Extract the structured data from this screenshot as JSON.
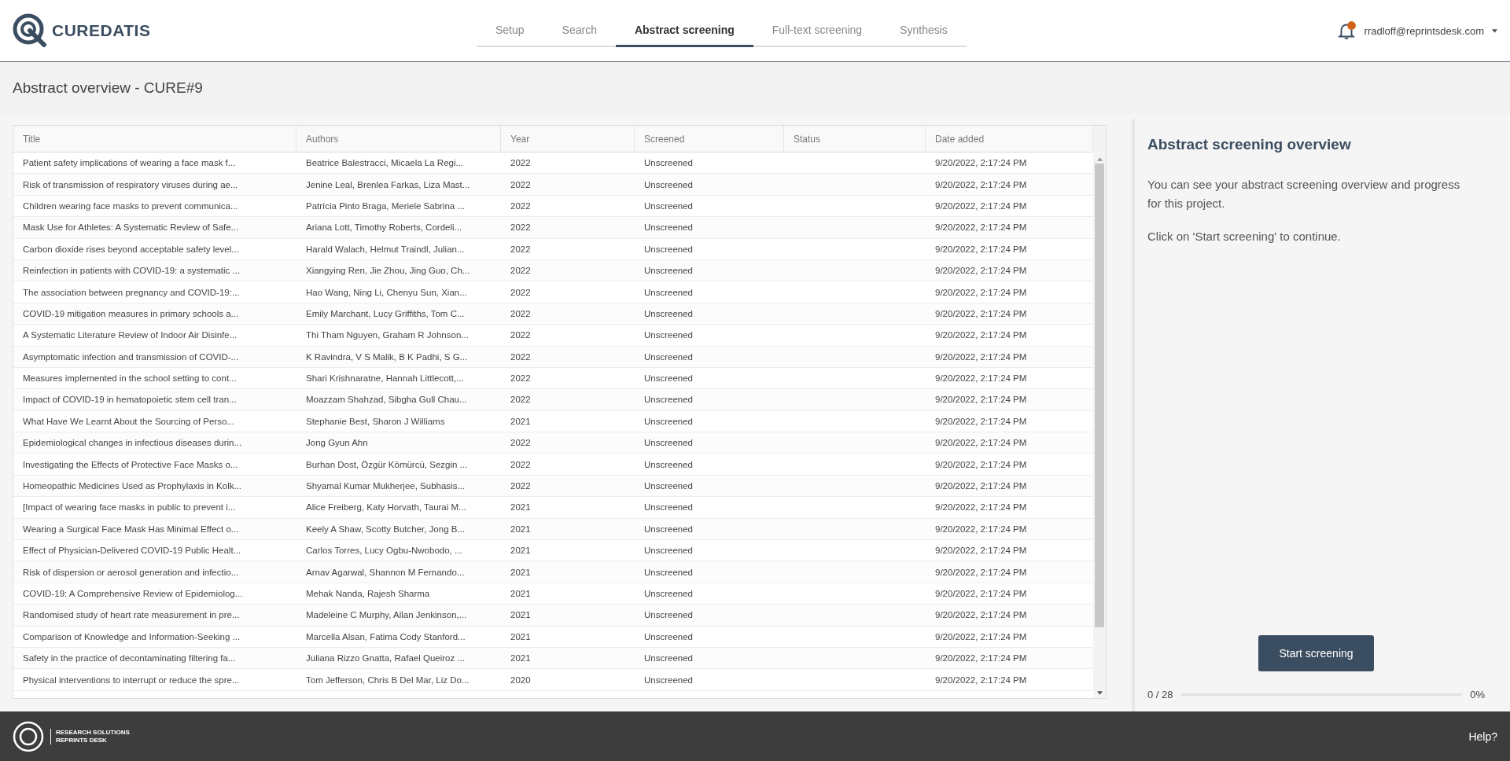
{
  "header": {
    "logo": "CUREDATIS",
    "tabs": [
      {
        "label": "Setup",
        "selected": false
      },
      {
        "label": "Search",
        "selected": false
      },
      {
        "label": "Abstract screening",
        "selected": true
      },
      {
        "label": "Full-text screening",
        "selected": false
      },
      {
        "label": "Synthesis",
        "selected": false
      }
    ],
    "user": "rradloff@reprintsdesk.com"
  },
  "page_title": "Abstract overview - CURE#9",
  "table": {
    "columns": [
      "Title",
      "Authors",
      "Year",
      "Screened",
      "Status",
      "Date added"
    ],
    "rows": [
      [
        "Patient safety implications of wearing a face mask f...",
        "Beatrice Balestracci, Micaela La Regi...",
        "2022",
        "Unscreened",
        "",
        "9/20/2022, 2:17:24 PM"
      ],
      [
        "Risk of transmission of respiratory viruses during ae...",
        "Jenine Leal, Brenlea Farkas, Liza Mast...",
        "2022",
        "Unscreened",
        "",
        "9/20/2022, 2:17:24 PM"
      ],
      [
        "Children wearing face masks to prevent communica...",
        "Patrícia Pinto Braga, Meriele Sabrina ...",
        "2022",
        "Unscreened",
        "",
        "9/20/2022, 2:17:24 PM"
      ],
      [
        "Mask Use for Athletes: A Systematic Review of Safe...",
        "Ariana Lott, Timothy Roberts, Cordeli...",
        "2022",
        "Unscreened",
        "",
        "9/20/2022, 2:17:24 PM"
      ],
      [
        "Carbon dioxide rises beyond acceptable safety level...",
        "Harald Walach, Helmut Traindl, Julian...",
        "2022",
        "Unscreened",
        "",
        "9/20/2022, 2:17:24 PM"
      ],
      [
        "Reinfection in patients with COVID-19: a systematic ...",
        "Xiangying Ren, Jie Zhou, Jing Guo, Ch...",
        "2022",
        "Unscreened",
        "",
        "9/20/2022, 2:17:24 PM"
      ],
      [
        "The association between pregnancy and COVID-19:...",
        "Hao Wang, Ning Li, Chenyu Sun, Xian...",
        "2022",
        "Unscreened",
        "",
        "9/20/2022, 2:17:24 PM"
      ],
      [
        "COVID-19 mitigation measures in primary schools a...",
        "Emily Marchant, Lucy Griffiths, Tom C...",
        "2022",
        "Unscreened",
        "",
        "9/20/2022, 2:17:24 PM"
      ],
      [
        "A Systematic Literature Review of Indoor Air Disinfe...",
        "Thi Tham Nguyen, Graham R Johnson...",
        "2022",
        "Unscreened",
        "",
        "9/20/2022, 2:17:24 PM"
      ],
      [
        "Asymptomatic infection and transmission of COVID-...",
        "K Ravindra, V S Malik, B K Padhi, S G...",
        "2022",
        "Unscreened",
        "",
        "9/20/2022, 2:17:24 PM"
      ],
      [
        "Measures implemented in the school setting to cont...",
        "Shari Krishnaratne, Hannah Littlecott,...",
        "2022",
        "Unscreened",
        "",
        "9/20/2022, 2:17:24 PM"
      ],
      [
        "Impact of COVID-19 in hematopoietic stem cell tran...",
        "Moazzam Shahzad, Sibgha Gull Chau...",
        "2022",
        "Unscreened",
        "",
        "9/20/2022, 2:17:24 PM"
      ],
      [
        "What Have We Learnt About the Sourcing of Perso...",
        "Stephanie Best, Sharon J Williams",
        "2021",
        "Unscreened",
        "",
        "9/20/2022, 2:17:24 PM"
      ],
      [
        "Epidemiological changes in infectious diseases durin...",
        "Jong Gyun Ahn",
        "2022",
        "Unscreened",
        "",
        "9/20/2022, 2:17:24 PM"
      ],
      [
        "Investigating the Effects of Protective Face Masks o...",
        "Burhan Dost, Özgür Kömürcü, Sezgin ...",
        "2022",
        "Unscreened",
        "",
        "9/20/2022, 2:17:24 PM"
      ],
      [
        "Homeopathic Medicines Used as Prophylaxis in Kolk...",
        "Shyamal Kumar Mukherjee, Subhasis...",
        "2022",
        "Unscreened",
        "",
        "9/20/2022, 2:17:24 PM"
      ],
      [
        "[Impact of wearing face masks in public to prevent i...",
        "Alice Freiberg, Katy Horvath, Taurai M...",
        "2021",
        "Unscreened",
        "",
        "9/20/2022, 2:17:24 PM"
      ],
      [
        "Wearing a Surgical Face Mask Has Minimal Effect o...",
        "Keely A Shaw, Scotty Butcher, Jong B...",
        "2021",
        "Unscreened",
        "",
        "9/20/2022, 2:17:24 PM"
      ],
      [
        "Effect of Physician-Delivered COVID-19 Public Healt...",
        "Carlos Torres, Lucy Ogbu-Nwobodo, ...",
        "2021",
        "Unscreened",
        "",
        "9/20/2022, 2:17:24 PM"
      ],
      [
        "Risk of dispersion or aerosol generation and infectio...",
        "Arnav Agarwal, Shannon M Fernando...",
        "2021",
        "Unscreened",
        "",
        "9/20/2022, 2:17:24 PM"
      ],
      [
        "COVID-19: A Comprehensive Review of Epidemiolog...",
        "Mehak Nanda, Rajesh Sharma",
        "2021",
        "Unscreened",
        "",
        "9/20/2022, 2:17:24 PM"
      ],
      [
        "Randomised study of heart rate measurement in pre...",
        "Madeleine C Murphy, Allan Jenkinson,...",
        "2021",
        "Unscreened",
        "",
        "9/20/2022, 2:17:24 PM"
      ],
      [
        "Comparison of Knowledge and Information-Seeking ...",
        "Marcella Alsan, Fatima Cody Stanford...",
        "2021",
        "Unscreened",
        "",
        "9/20/2022, 2:17:24 PM"
      ],
      [
        "Safety in the practice of decontaminating filtering fa...",
        "Juliana Rizzo Gnatta, Rafael Queiroz ...",
        "2021",
        "Unscreened",
        "",
        "9/20/2022, 2:17:24 PM"
      ],
      [
        "Physical interventions to interrupt or reduce the spre...",
        "Tom Jefferson, Chris B Del Mar, Liz Do...",
        "2020",
        "Unscreened",
        "",
        "9/20/2022, 2:17:24 PM"
      ]
    ]
  },
  "panel": {
    "title": "Abstract screening overview",
    "paragraphs": [
      "You can see your abstract screening overview and progress for this project.",
      "Click on 'Start screening' to continue."
    ],
    "button": "Start screening",
    "progress": {
      "count": "0 / 28",
      "level": 0,
      "percent": "0%"
    }
  },
  "footer": {
    "brand_lines": [
      "RESEARCH SOLUTIONS",
      "REPRINTS DESK"
    ],
    "help": "Help?"
  }
}
